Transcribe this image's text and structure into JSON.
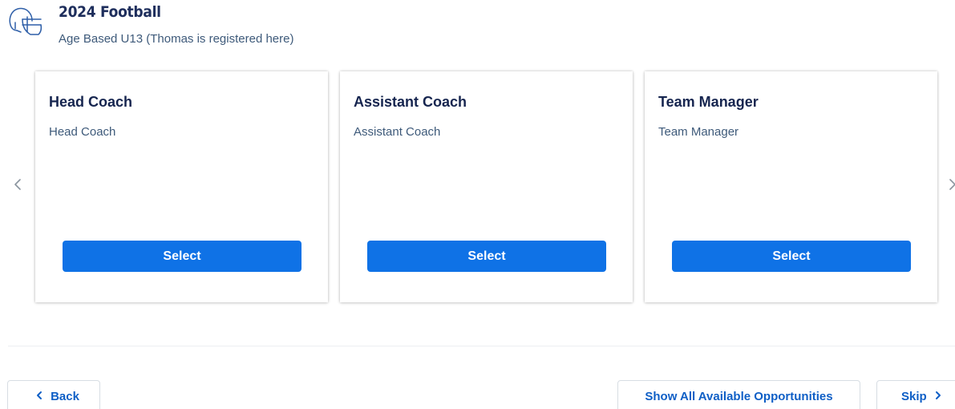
{
  "header": {
    "icon": "football-helmet-icon",
    "title": "2024 Football",
    "subtitle": "Age Based U13 (Thomas is registered here)"
  },
  "carousel": {
    "prev_icon": "chevron-left-icon",
    "next_icon": "chevron-right-icon",
    "cards": [
      {
        "title": "Head Coach",
        "description": "Head Coach",
        "button_label": "Select"
      },
      {
        "title": "Assistant Coach",
        "description": "Assistant Coach",
        "button_label": "Select"
      },
      {
        "title": "Team Manager",
        "description": "Team Manager",
        "button_label": "Select"
      }
    ]
  },
  "footer": {
    "back_label": "Back",
    "show_all_label": "Show All Available Opportunities",
    "skip_label": "Skip"
  },
  "colors": {
    "primary_button": "#0f72e6",
    "link_text": "#0f5fc6",
    "title_text": "#1e2e5c",
    "muted_text": "#3e5a7a"
  }
}
